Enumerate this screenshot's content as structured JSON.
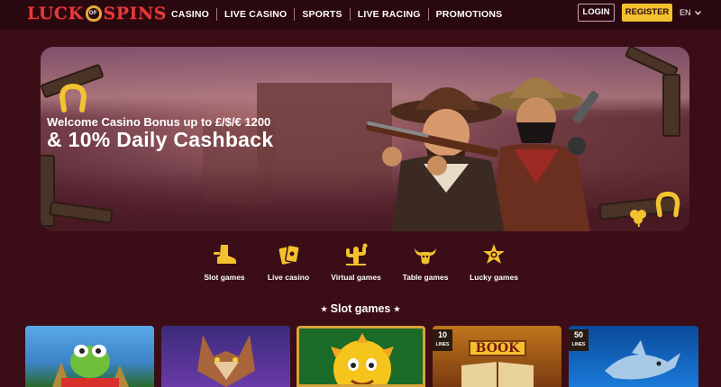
{
  "header": {
    "logo": {
      "left": "LUCK",
      "of": "OF",
      "right": "SPINS"
    },
    "nav": [
      "CASINO",
      "LIVE CASINO",
      "SPORTS",
      "LIVE RACING",
      "PROMOTIONS"
    ],
    "login_label": "LOGIN",
    "register_label": "REGISTER",
    "language": "EN"
  },
  "banner": {
    "subtitle": "Welcome Casino Bonus up to £/$/€ 1200",
    "title": "& 10% Daily Cashback"
  },
  "categories": [
    {
      "label": "Slot games",
      "icon": "boot-icon"
    },
    {
      "label": "Live casino",
      "icon": "cards-icon"
    },
    {
      "label": "Virtual games",
      "icon": "cactus-icon"
    },
    {
      "label": "Table games",
      "icon": "bull-skull-icon"
    },
    {
      "label": "Lucky games",
      "icon": "sheriff-star-icon"
    }
  ],
  "section_title": "Slot games",
  "games": [
    {
      "badge": "",
      "theme": "frog-game"
    },
    {
      "badge": "",
      "theme": "wolf-game"
    },
    {
      "badge": "",
      "theme": "sun-game"
    },
    {
      "badge": "10",
      "badge_sub": "LINES",
      "title": "BOOK",
      "theme": "book-game"
    },
    {
      "badge": "50",
      "badge_sub": "LINES",
      "theme": "shark-game"
    }
  ],
  "colors": {
    "accent": "#f3c12e",
    "background": "#3a0d17",
    "header": "#2a0810",
    "logo_red": "#e53a3a"
  }
}
